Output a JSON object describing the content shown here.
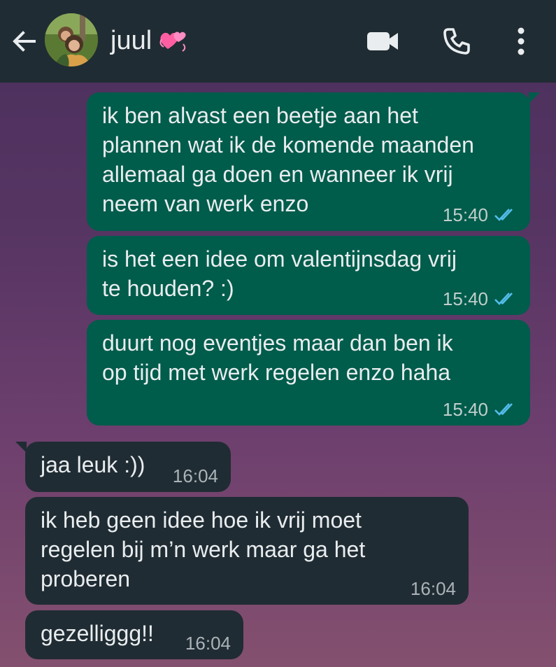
{
  "header": {
    "contact_name": "juul",
    "back_icon": "arrow-left-icon",
    "emoji_icon": "two-hearts-icon",
    "video_icon": "video-camera-icon",
    "call_icon": "phone-icon",
    "more_icon": "vertical-dots-icon"
  },
  "messages": [
    {
      "direction": "outgoing",
      "text": "ik ben alvast een beetje aan het\nplannen wat ik de komende maanden\nallemaal ga doen en wanneer ik vrij\nneem van werk enzo",
      "time": "15:40",
      "status": "read"
    },
    {
      "direction": "outgoing",
      "text": "is het een idee om valentijnsdag vrij\nte houden? :)",
      "time": "15:40",
      "status": "read"
    },
    {
      "direction": "outgoing",
      "text": "duurt nog eventjes maar dan ben ik\nop tijd met werk regelen enzo haha",
      "time": "15:40",
      "status": "read"
    },
    {
      "direction": "incoming",
      "text": "jaa leuk :))",
      "time": "16:04"
    },
    {
      "direction": "incoming",
      "text": "ik heb geen idee hoe ik vrij moet\nregelen bij m’n werk maar ga het\nproberen",
      "time": "16:04"
    },
    {
      "direction": "incoming",
      "text": "gezelliggg!!",
      "time": "16:04"
    }
  ],
  "colors": {
    "header_bg": "#202c33",
    "outgoing_bubble": "#005c4b",
    "incoming_bubble": "#202c33",
    "read_tick": "#53bdeb"
  }
}
